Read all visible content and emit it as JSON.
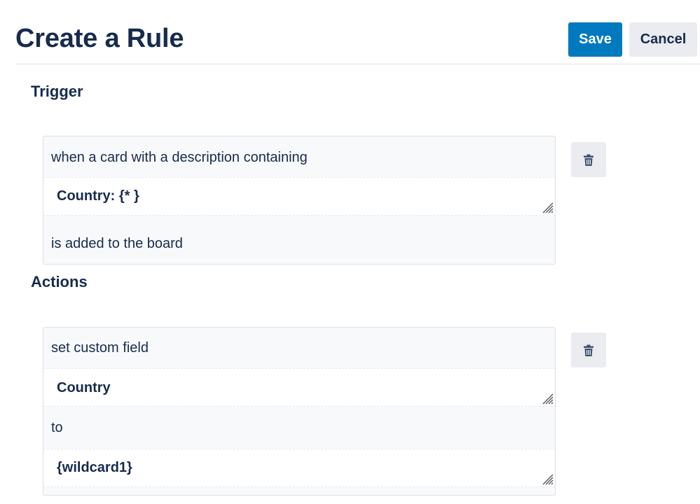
{
  "header": {
    "title": "Create a Rule",
    "save_label": "Save",
    "cancel_label": "Cancel"
  },
  "trigger": {
    "heading": "Trigger",
    "prefix": "when a card with a description containing",
    "value": "Country: {* }",
    "suffix": "is added to the board"
  },
  "actions": {
    "heading": "Actions",
    "prefix": "set custom field",
    "field_value": "Country",
    "connector": "to",
    "target_value": "{wildcard1}"
  },
  "icons": {
    "delete": "trash-icon",
    "resize": "resize-grip-icon"
  },
  "colors": {
    "primary": "#0079bf",
    "text": "#172b4d",
    "neutral_button": "#ebecf0"
  }
}
